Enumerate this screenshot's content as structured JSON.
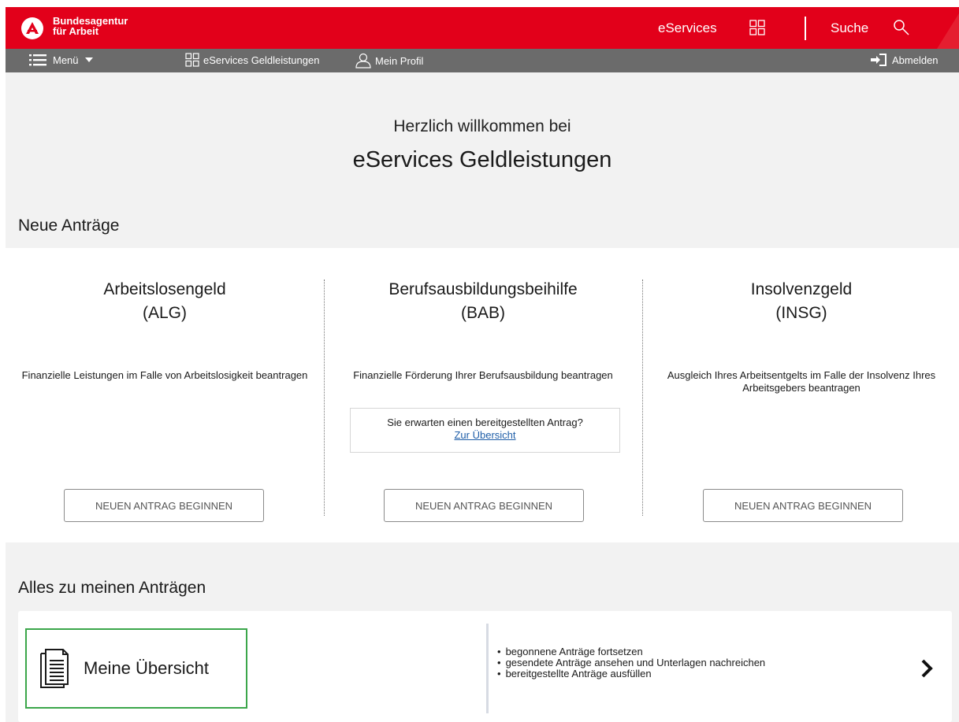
{
  "header": {
    "brand_line1": "Bundesagentur",
    "brand_line2": "für Arbeit",
    "eservices_label": "eServices",
    "search_label": "Suche"
  },
  "nav": {
    "menu_label": "Menü",
    "eservices_label": "eServices Geldleistungen",
    "profile_label": "Mein Profil",
    "logout_label": "Abmelden"
  },
  "welcome": {
    "line1": "Herzlich willkommen bei",
    "line2": "eServices Geldleistungen"
  },
  "new_applications": {
    "title": "Neue Anträge",
    "items": [
      {
        "title": "Arbeitslosengeld",
        "abbr": "(ALG)",
        "description": "Finanzielle Leistungen im Falle von Arbeitslosigkeit beantragen",
        "button": "NEUEN ANTRAG BEGINNEN"
      },
      {
        "title": "Berufsausbildungsbeihilfe",
        "abbr": "(BAB)",
        "description": "Finanzielle Förderung Ihrer Berufsausbildung beantragen",
        "hint_question": "Sie erwarten einen bereitgestellten Antrag?",
        "hint_link": "Zur Übersicht",
        "button": "NEUEN ANTRAG BEGINNEN"
      },
      {
        "title": "Insolvenzgeld",
        "abbr": "(INSG)",
        "description": "Ausgleich Ihres Arbeitsentgelts im Falle der Insolvenz Ihres Arbeitsgebers beantragen",
        "button": "NEUEN ANTRAG BEGINNEN"
      }
    ]
  },
  "my_applications": {
    "title": "Alles zu meinen Anträgen",
    "overview_label": "Meine Übersicht",
    "bullets": [
      "begonnene Anträge fortsetzen",
      "gesendete Anträge ansehen und Unterlagen nachreichen",
      "bereitgestellte Anträge ausfüllen"
    ]
  },
  "colors": {
    "brand_red": "#e2001a",
    "nav_gray": "#6b6b6b",
    "page_bg": "#f2f2f2",
    "highlight_green": "#3ba64a",
    "link_blue": "#1f5ea8"
  }
}
